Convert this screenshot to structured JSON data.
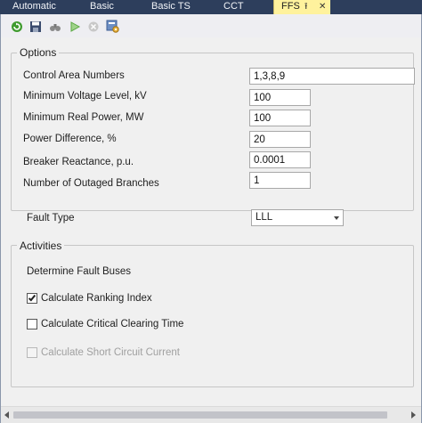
{
  "tabs": [
    {
      "label": "Automatic"
    },
    {
      "label": "Basic"
    },
    {
      "label": "Basic TS"
    },
    {
      "label": "CCT"
    },
    {
      "label": "FFS"
    }
  ],
  "tab_controls": {
    "pin": "⭱",
    "close": "✕"
  },
  "toolbar": {
    "icons": [
      "refresh-icon",
      "save-icon",
      "binoculars-icon",
      "run-icon",
      "stop-icon",
      "settings-icon"
    ]
  },
  "options": {
    "title": "Options",
    "fields": [
      {
        "label": "Control Area Numbers",
        "value": "1,3,8,9"
      },
      {
        "label": "Minimum Voltage Level, kV",
        "value": "100"
      },
      {
        "label": "Minimum Real Power, MW",
        "value": "100"
      },
      {
        "label": "Power Difference, %",
        "value": "20"
      },
      {
        "label": "Breaker Reactance, p.u.",
        "value": "0.0001"
      },
      {
        "label": "Number of Outaged Branches",
        "value": "1"
      }
    ]
  },
  "fault_type": {
    "label": "Fault Type",
    "value": "LLL"
  },
  "activities": {
    "title": "Activities",
    "heading": "Determine Fault Buses",
    "checks": [
      {
        "label": "Calculate Ranking Index",
        "checked": true,
        "enabled": true
      },
      {
        "label": "Calculate Critical Clearing Time",
        "checked": false,
        "enabled": true
      },
      {
        "label": "Calculate Short Circuit Current",
        "checked": false,
        "enabled": false
      }
    ]
  },
  "colors": {
    "tabbar": "#2d3e5c",
    "active_tab": "#fff29d",
    "panel": "#f0f0f0"
  }
}
